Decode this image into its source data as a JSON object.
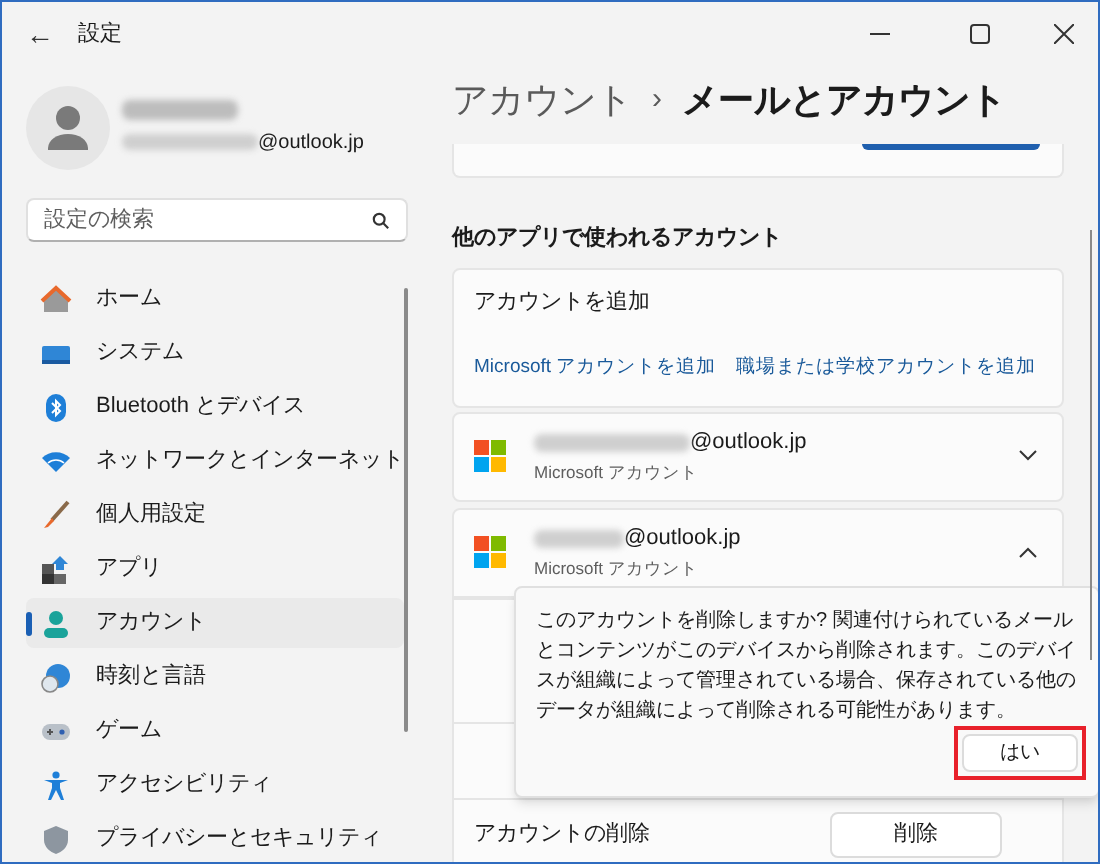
{
  "window": {
    "back": "←",
    "title": "設定"
  },
  "profile": {
    "email_suffix": "@outlook.jp"
  },
  "search": {
    "placeholder": "設定の検索"
  },
  "nav": [
    {
      "label": "ホーム",
      "selected": false
    },
    {
      "label": "システム",
      "selected": false
    },
    {
      "label": "Bluetooth とデバイス",
      "selected": false
    },
    {
      "label": "ネットワークとインターネット",
      "selected": false
    },
    {
      "label": "個人用設定",
      "selected": false
    },
    {
      "label": "アプリ",
      "selected": false
    },
    {
      "label": "アカウント",
      "selected": true
    },
    {
      "label": "時刻と言語",
      "selected": false
    },
    {
      "label": "ゲーム",
      "selected": false
    },
    {
      "label": "アクセシビリティ",
      "selected": false
    },
    {
      "label": "プライバシーとセキュリティ",
      "selected": false
    }
  ],
  "header": {
    "parent": "アカウント",
    "separator": "›",
    "title": "メールとアカウント"
  },
  "section_heading": "他のアプリで使われるアカウント",
  "add_card": {
    "title": "アカウントを追加",
    "links": [
      "Microsoft アカウントを追加",
      "職場または学校アカウントを追加"
    ]
  },
  "accounts": [
    {
      "email_suffix": "@outlook.jp",
      "type": "Microsoft アカウント",
      "expanded": false
    },
    {
      "email_suffix": "@outlook.jp",
      "type": "Microsoft アカウント",
      "expanded": true
    }
  ],
  "remove_row": {
    "label": "アカウントの削除",
    "button": "削除"
  },
  "confirm_flyout": {
    "message": "このアカウントを削除しますか? 関連付けられているメールとコンテンツがこのデバイスから削除されます。このデバイスが組織によって管理されている場合、保存されている他のデータが組織によって削除される可能性があります。",
    "button": "はい",
    "highlighted": true
  }
}
